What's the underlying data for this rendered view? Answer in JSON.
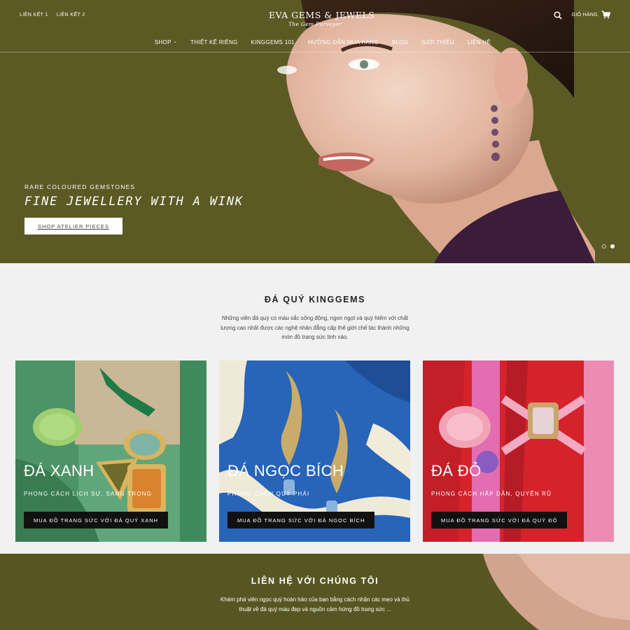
{
  "header": {
    "top_links": [
      "LIÊN KẾT 1",
      "LIÊN KẾT 2"
    ],
    "logo_main": "EVA GEMS & JEWELS",
    "logo_sub": "The Gem Purveyor",
    "cart_label": "GIỎ HÀNG",
    "nav": [
      {
        "label": "SHOP",
        "has_dropdown": true
      },
      {
        "label": "THIẾT KẾ RIÊNG"
      },
      {
        "label": "KINGGEMS 101"
      },
      {
        "label": "HƯỚNG DẪN MUA HÀNG"
      },
      {
        "label": "BLOG"
      },
      {
        "label": "GIỚI THIỆU"
      },
      {
        "label": "LIÊN HỆ"
      }
    ]
  },
  "hero": {
    "eyebrow": "RARE COLOURED GEMSTONES",
    "title": "FINE JEWELLERY WITH A WINK",
    "button": "SHOP ATELIER PIECES",
    "slides": 2,
    "active_slide": 2
  },
  "intro": {
    "title": "ĐÁ QUÝ KINGGEMS",
    "description": "Những viên đá quý có màu sắc sống động, ngon ngọt và quý hiếm với chất lượng cao nhất được các nghệ nhân đẳng cấp thế giới chế tác thành những món đồ trang sức tinh xảo."
  },
  "cards": [
    {
      "title": "ĐÁ XANH",
      "subtitle": "PHONG CÁCH LỊCH SỰ, SANG TRỌNG",
      "button": "MUA ĐỒ TRANG SỨC VỚI ĐÁ QUÝ XANH"
    },
    {
      "title": "ĐÁ NGỌC BÍCH",
      "subtitle": "PHONG CÁCH QUÝ PHÁI",
      "button": "MUA ĐỒ TRANG SỨC VỚI ĐÁ NGỌC BÍCH"
    },
    {
      "title": "ĐÁ ĐỎ",
      "subtitle": "PHONG CÁCH HẤP DẪN, QUYẾN RŨ",
      "button": "MUA ĐỒ TRANG SỨC VỚI ĐÁ QUÝ ĐỎ"
    }
  ],
  "contact": {
    "title": "LIÊN HỆ VỚI CHÚNG TÔI",
    "description": "Khám phá viên ngọc quý hoàn hảo của bạn bằng cách nhận các mẹo và thủ thuật về đá quý màu đẹp và nguồn cảm hứng đồ trang sức ..."
  },
  "colors": {
    "olive": "#5b5a24",
    "section_bg": "#f1f1f1",
    "button_dark": "#111111"
  },
  "icons": [
    "search-icon",
    "cart-icon",
    "chevron-down-icon"
  ]
}
